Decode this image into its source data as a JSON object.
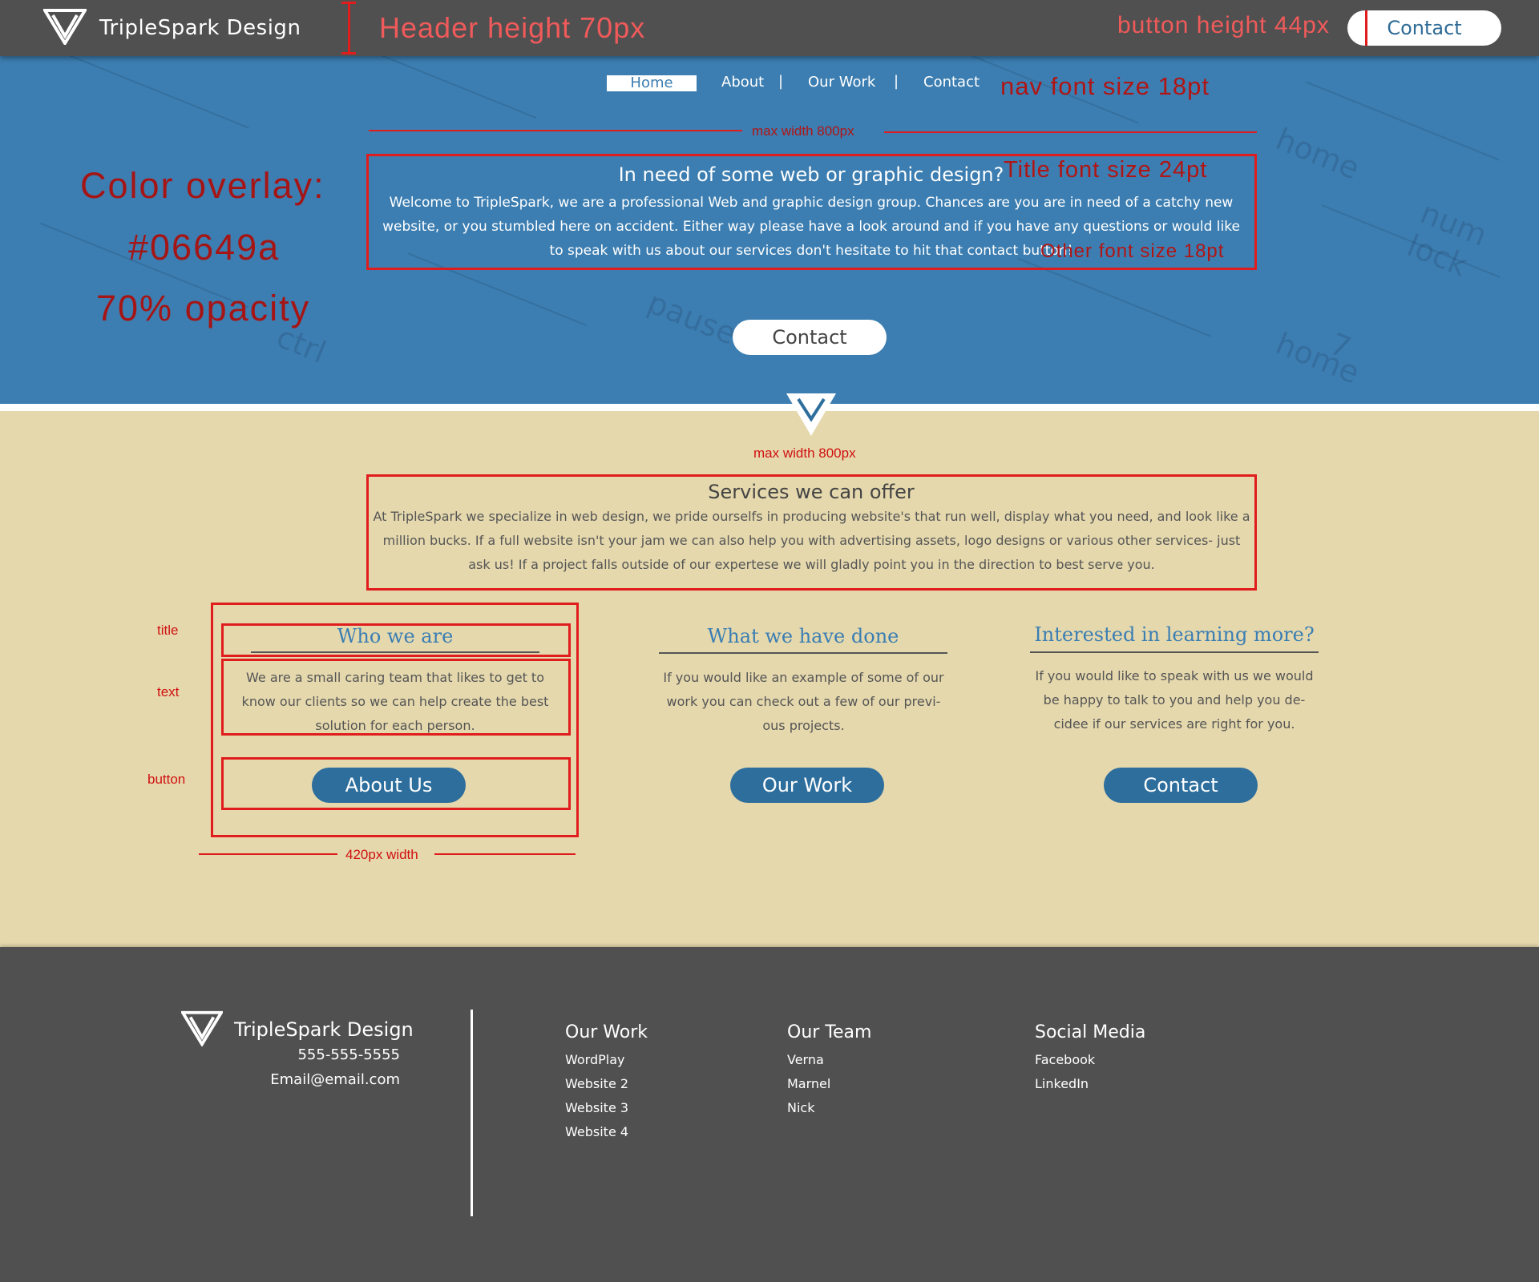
{
  "brand": {
    "name": "TripleSpark Design",
    "logo_icon": "triangle-logo-icon"
  },
  "header": {
    "contact_label": "Contact"
  },
  "nav": {
    "items": [
      "Home",
      "About",
      "Our Work",
      "Contact"
    ],
    "separator": "|"
  },
  "hero": {
    "title": "In need of some web or graphic design?",
    "text": "Welcome to TripleSpark, we are a professional Web and graphic design group. Chances are you are in need of a catchy new website, or you stumbled here on accident. Either way please have a look around and if you have any questions or would like to speak with us about our services don't hesitate to hit that contact button!",
    "button_label": "Contact",
    "texture_keys": [
      "pause",
      "ctrl",
      "home",
      "num lock",
      "7",
      "home"
    ]
  },
  "services": {
    "title": "Services we can offer",
    "text": "At TripleSpark we specialize in web design, we pride ourselfs in producing website's that run well, display what you need, and look like a million bucks. If a full website isn't your jam we can also help you with advertising assets, logo designs or various other services- just ask us! If a project falls outside of our expertese we will gladly point you in the direction to best serve you."
  },
  "columns": [
    {
      "title": "Who we are",
      "text": "We are a small caring team that likes to get to know our clients so we can help create the best solution for each person.",
      "button": "About Us"
    },
    {
      "title": "What we have done",
      "text": "If you would like an example of some of our work you can check out a few of our previ- ous projects.",
      "button": "Our Work"
    },
    {
      "title": "Interested in learning more?",
      "text": "If you would like to speak with us we would be happy to talk to you and help you de- cidee if our services are right for you.",
      "button": "Contact"
    }
  ],
  "annotations": {
    "header_height": "Header height 70px",
    "button_height": "button height 44px",
    "nav_font": "nav font size 18pt",
    "max_width_top": "max width 800px",
    "title_font": "Title font size 24pt",
    "other_font": "Other font size 18pt",
    "overlay_line1": "Color overlay:",
    "overlay_line2": "#06649a",
    "overlay_line3": "70% opacity",
    "max_width_mid": "max width 800px",
    "label_title": "title",
    "label_text": "text",
    "label_button": "button",
    "width_label": "420px width"
  },
  "footer": {
    "brand_name": "TripleSpark Design",
    "phone": "555-555-5555",
    "email": "Email@email.com",
    "groups": [
      {
        "heading": "Our Work",
        "links": [
          "WordPlay",
          "Website 2",
          "Website 3",
          "Website 4"
        ]
      },
      {
        "heading": "Our Team",
        "links": [
          "Verna",
          "Marnel",
          "Nick"
        ]
      },
      {
        "heading": "Social Media",
        "links": [
          "Facebook",
          "LinkedIn"
        ]
      }
    ]
  },
  "colors": {
    "header_bg": "#505050",
    "hero_overlay": "#06649a",
    "accent_blue": "#2d6e9d",
    "section_bg": "#e5d8ad",
    "annotation_red": "#e01c1c"
  }
}
